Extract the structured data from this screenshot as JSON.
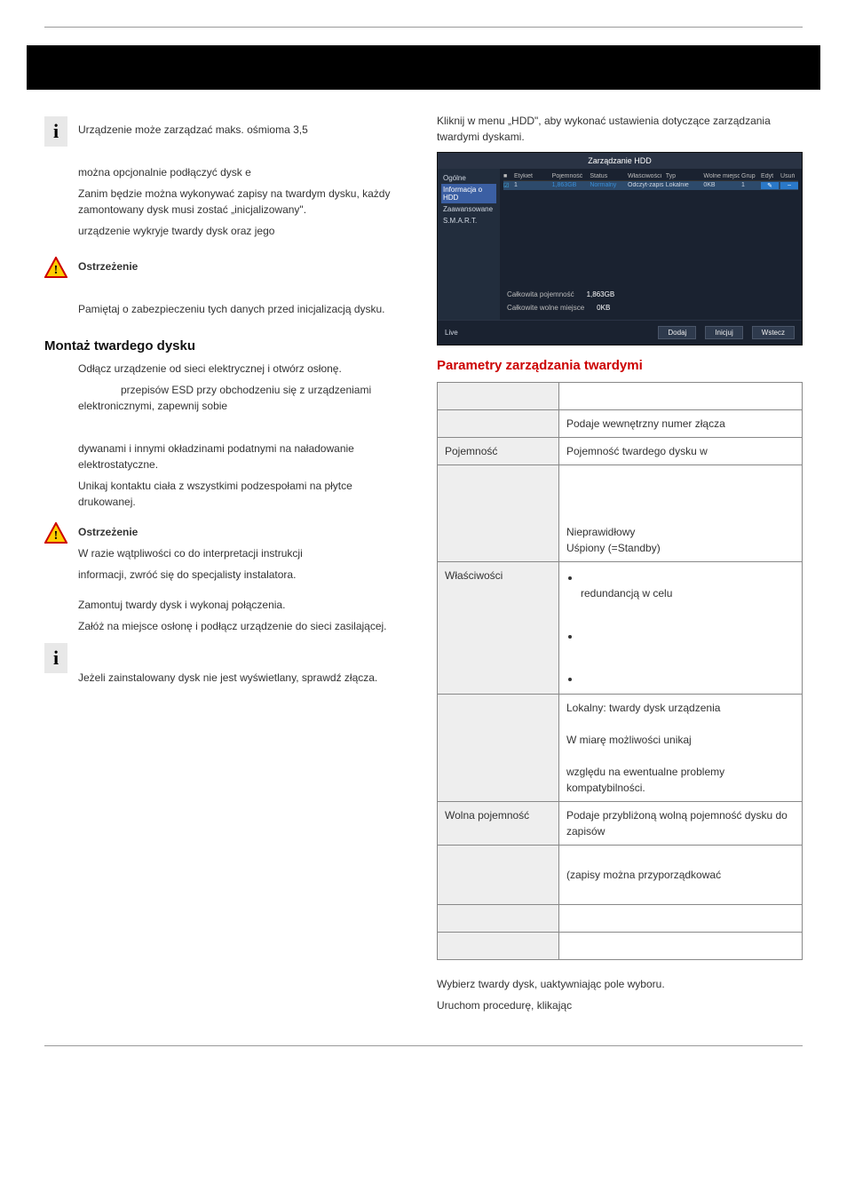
{
  "intro": {
    "para1": "Kliknij w menu „HDD\", aby wykonać ustawienia dotyczące zarządzania twardymi dyskami."
  },
  "info1": {
    "line1": "Urządzenie może zarządzać maks. ośmioma 3,5",
    "line2": "można opcjonalnie podłączyć dysk e",
    "line3": "Zanim będzie można wykonywać zapisy na twardym dysku, każdy zamontowany dysk musi zostać „inicjalizowany\".",
    "line4": "urządzenie wykryje twardy dysk oraz jego"
  },
  "warn1": {
    "title": "Ostrzeżenie",
    "text": "Pamiętaj o zabezpieczeniu tych danych przed inicjalizacją dysku."
  },
  "mount": {
    "heading": "Montaż twardego dysku",
    "p1": "Odłącz urządzenie od sieci elektrycznej i otwórz osłonę.",
    "p2a": "przepisów ESD przy obchodzeniu się z urządzeniami elektronicznymi, zapewnij sobie",
    "p3": "dywanami i innymi okładzinami podatnymi na naładowanie elektrostatyczne.",
    "p4": "Unikaj kontaktu ciała z wszystkimi podzespołami na płytce drukowanej.",
    "warn_title": "Ostrzeżenie",
    "warn_text1": "W razie wątpliwości co do interpretacji instrukcji",
    "warn_text2": "informacji, zwróć się do specjalisty instalatora.",
    "p5": "Zamontuj twardy dysk i wykonaj połączenia.",
    "p6": "Załóż na miejsce osłonę i podłącz urządzenie do sieci zasilającej."
  },
  "info2": {
    "text": "Jeżeli zainstalowany dysk nie jest wyświetlany, sprawdź złącza."
  },
  "hdd_img": {
    "title": "Zarządzanie HDD",
    "side": {
      "ogolne": "Ogólne",
      "info": "Informacja o HDD",
      "zaaw": "Zaawansowane",
      "smart": "S.M.A.R.T."
    },
    "head": {
      "etykieta": "Etykiet",
      "poj": "Pojemność",
      "status": "Status",
      "wlas": "Właściwości",
      "typ": "Typ",
      "wolne": "Wolne miejsc",
      "gr": "Grup",
      "ed": "Edyt",
      "us": "Usuń"
    },
    "row": {
      "num": "1",
      "cap": "1,863GB",
      "status": "Normalny",
      "prop": "Odczyt-zapis",
      "type": "Lokalnie",
      "free": "0KB",
      "grp": "1"
    },
    "sum1l": "Całkowita pojemność",
    "sum1v": "1,863GB",
    "sum2l": "Całkowite wolne miejsce",
    "sum2v": "0KB",
    "live": "Live",
    "btn1": "Dodaj",
    "btn2": "Inicjuj",
    "btn3": "Wstecz"
  },
  "params_heading": "Parametry zarządzania twardymi",
  "table": {
    "r1_right": "Podaje wewnętrzny numer złącza",
    "r2_left": "Pojemność",
    "r2_right": "Pojemność twardego dysku w",
    "r3_right_a": "Nieprawidłowy",
    "r3_right_b": "Uśpiony (=Standby)",
    "r4_left": "Właściwości",
    "r4_bullet1": "redundancją w celu",
    "r5_right_a": "Lokalny: twardy dysk urządzenia",
    "r5_right_b": "W miarę możliwości unikaj",
    "r5_right_c": "względu na ewentualne problemy kompatybilności.",
    "r6_left": "Wolna pojemność",
    "r6_right": "Podaje przybliżoną wolną pojemność dysku do zapisów",
    "r7_right": "(zapisy można przyporządkować"
  },
  "outro": {
    "p1": "Wybierz twardy dysk, uaktywniając pole wyboru.",
    "p2": "Uruchom procedurę, klikając"
  }
}
